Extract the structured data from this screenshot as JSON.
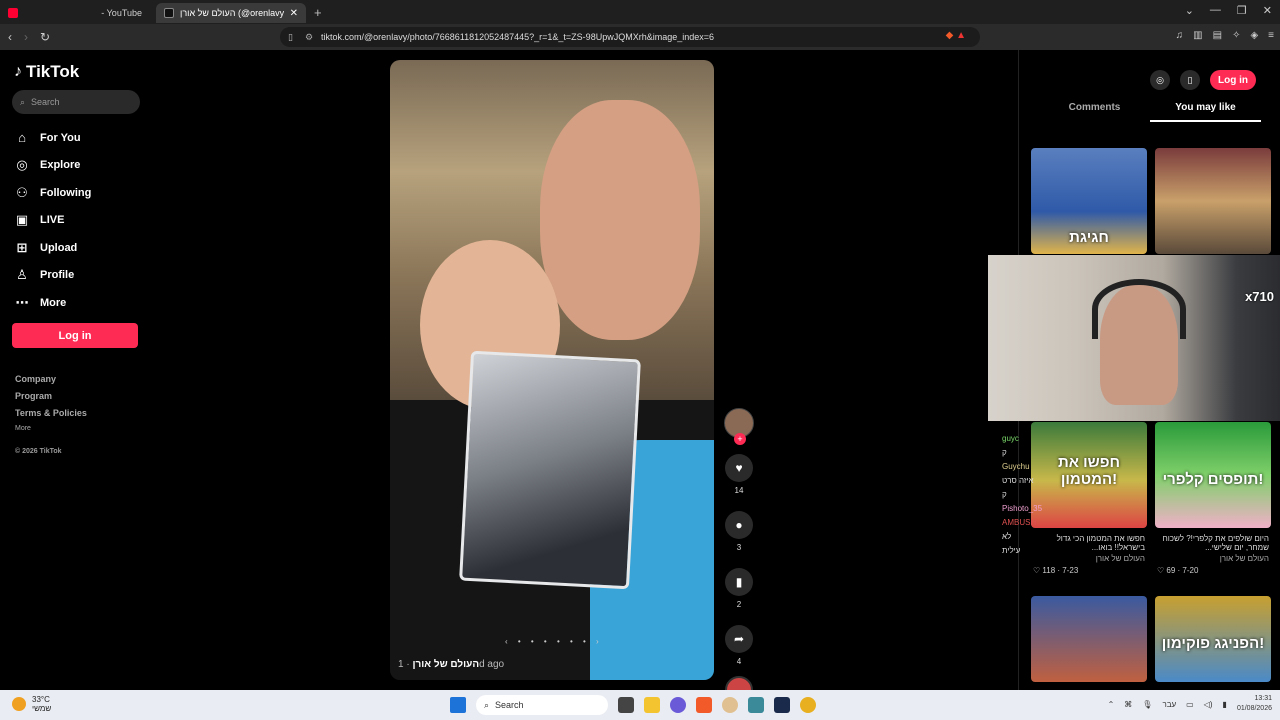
{
  "browser": {
    "tabs": [
      {
        "title": "- YouTube",
        "color": "#ff0033"
      },
      {
        "title": "העולם של אורן (@orenlavy) | Tok",
        "color": "#111111"
      }
    ],
    "new_tab": "+",
    "window_controls": [
      "⌄",
      "—",
      "❐",
      "✕"
    ],
    "url": "tiktok.com/@orenlavy/photo/7668611812052487445?_r=1&_t=ZS-98UpwJQMXrh&image_index=6"
  },
  "sidebar": {
    "brand": "TikTok",
    "search_placeholder": "Search",
    "items": [
      {
        "label": "For You",
        "icon": "home-icon",
        "glyph": "⌂"
      },
      {
        "label": "Explore",
        "icon": "compass-icon",
        "glyph": "◎"
      },
      {
        "label": "Following",
        "icon": "following-icon",
        "glyph": "⚇"
      },
      {
        "label": "LIVE",
        "icon": "live-icon",
        "glyph": "▣"
      },
      {
        "label": "Upload",
        "icon": "upload-icon",
        "glyph": "⊞"
      },
      {
        "label": "Profile",
        "icon": "profile-icon",
        "glyph": "♙"
      },
      {
        "label": "More",
        "icon": "more-icon",
        "glyph": "⋯"
      }
    ],
    "login": "Log in",
    "footer": [
      "Company",
      "Program",
      "Terms & Policies"
    ],
    "footer_more": "More",
    "copyright": "© 2026 TikTok"
  },
  "post": {
    "author": "העולם של אורן",
    "age": "· 1d ago",
    "likes": "14",
    "comments": "3",
    "saves": "2",
    "shares": "4"
  },
  "right_panel": {
    "login": "Log in",
    "tabs": [
      "Comments",
      "You may like"
    ],
    "videos": [
      {
        "overlay": "חגיגת",
        "title": "",
        "author": "",
        "stats": ""
      },
      {
        "overlay": "",
        "title": "",
        "author": "",
        "stats": ""
      },
      {
        "overlay": "חפשו את המטמון!",
        "title": "חפשו את המטמון הכי גדול בישראל!! בואו...",
        "author": "העולם של אורן",
        "stats": "♡ 118 · 7-23"
      },
      {
        "overlay": "תופסים קלפרי!",
        "title": "היום שולפים את קלפרי!? לשכוח שמחר, יום שלישי...",
        "author": "העולם של אורן",
        "stats": "♡ 69 · 7-20"
      },
      {
        "overlay": "",
        "title": "",
        "author": "",
        "stats": ""
      },
      {
        "overlay": "הפניגג פוקימון!",
        "title": "",
        "author": "",
        "stats": ""
      }
    ]
  },
  "stream": {
    "badge": "x710",
    "chat": [
      "guyc",
      "ק",
      "Guychu",
      "איזה סרט",
      "ק",
      "Pishoto_35",
      "AMBUSH",
      "לא",
      "עילית"
    ]
  },
  "taskbar": {
    "weather_temp": "33°C",
    "weather_desc": "שמשי",
    "search": "Search",
    "lang": "עבר",
    "time": "13:31",
    "date": "01/08/2026"
  }
}
